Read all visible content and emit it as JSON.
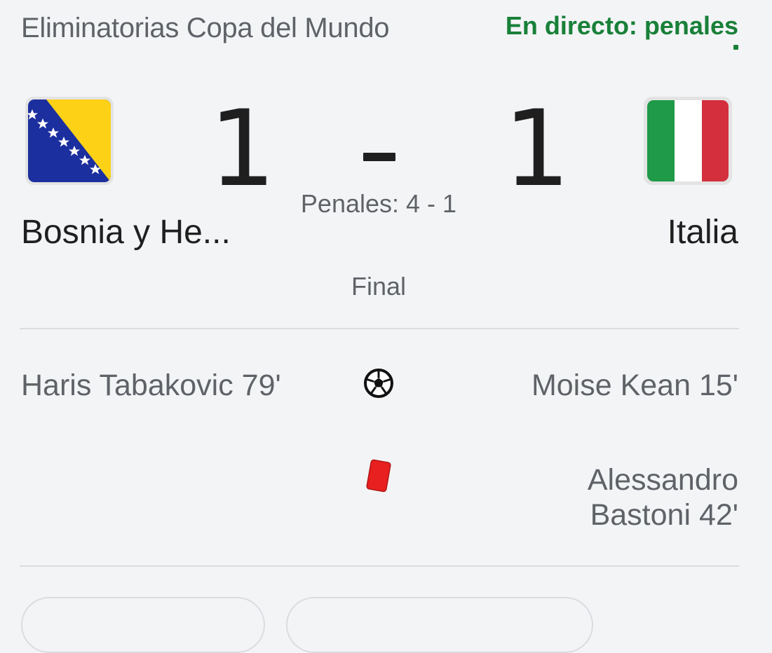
{
  "header": {
    "competition": "Eliminatorias Copa del Mundo",
    "live_status": "En directo: penales",
    "accent_color": "#188038"
  },
  "match": {
    "home": {
      "name": "Bosnia y He...",
      "score": "1",
      "flag_icon": "bosnia-herzegovina-flag"
    },
    "away": {
      "name": "Italia",
      "score": "1",
      "flag_icon": "italy-flag"
    },
    "penalties": "Penales: 4 - 1",
    "status": "Final"
  },
  "events": {
    "goals": {
      "icon": "soccer-ball-icon",
      "home": "Haris Tabakovic 79'",
      "away": "Moise Kean 15'"
    },
    "red_cards": {
      "icon": "red-card-icon",
      "card_color": "#e8201f",
      "away_line1": "Alessandro",
      "away_line2": "Bastoni 42'"
    }
  }
}
